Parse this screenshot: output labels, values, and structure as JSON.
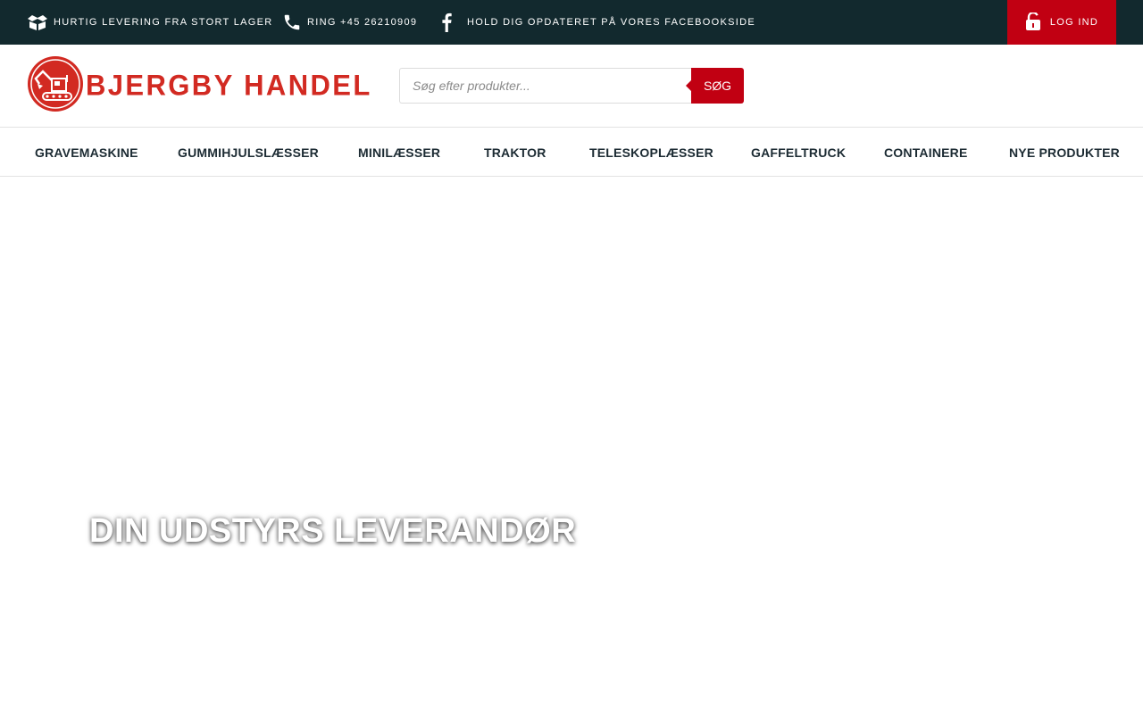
{
  "topbar": {
    "delivery": {
      "icon": "box-icon",
      "label": "HURTIG LEVERING FRA STORT LAGER"
    },
    "phone": {
      "icon": "phone-icon",
      "label": "RING +45 26210909"
    },
    "facebook": {
      "icon": "facebook-icon",
      "label": "HOLD DIG OPDATERET PÅ VORES FACEBOOKSIDE"
    },
    "login": {
      "icon": "unlock-icon",
      "label": "LOG IND"
    }
  },
  "header": {
    "logo_text": "BJERGBY HANDEL",
    "search": {
      "placeholder": "Søg efter produkter...",
      "value": "",
      "button_label": "SØG"
    }
  },
  "nav": {
    "items": [
      {
        "label": "GRAVEMASKINE"
      },
      {
        "label": "GUMMIHJULSLÆSSER"
      },
      {
        "label": "MINILÆSSER"
      },
      {
        "label": "TRAKTOR"
      },
      {
        "label": "TELESKOPLÆSSER"
      },
      {
        "label": "GAFFELTRUCK"
      },
      {
        "label": "CONTAINERE"
      },
      {
        "label": "NYE PRODUKTER"
      }
    ]
  },
  "hero": {
    "title": "DIN UDSTYRS LEVERANDØR"
  },
  "colors": {
    "topbar_bg": "#12292e",
    "accent": "#c10012",
    "logo_red": "#d22a22",
    "nav_text": "#1c2b33"
  }
}
